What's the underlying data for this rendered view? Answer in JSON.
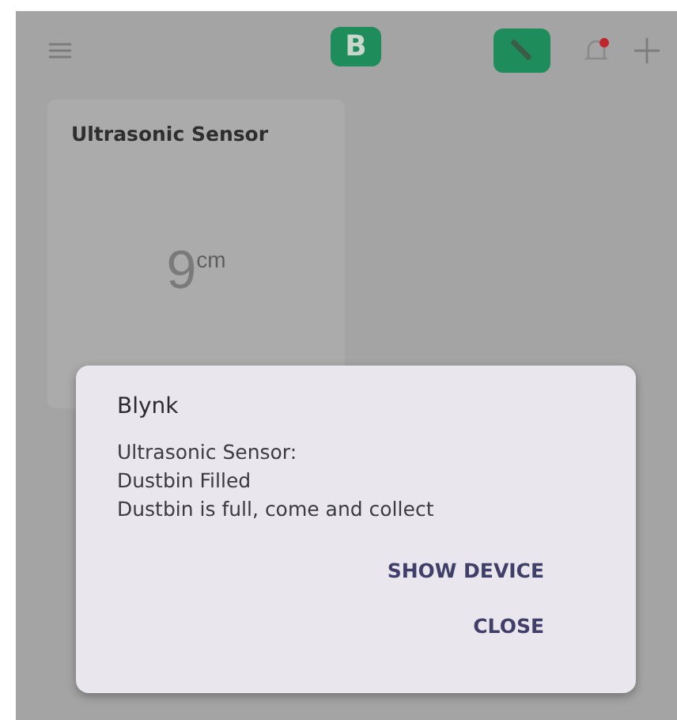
{
  "header": {
    "logo": "B"
  },
  "widget": {
    "title": "Ultrasonic Sensor",
    "value": "9",
    "unit": "cm"
  },
  "dialog": {
    "title": "Blynk",
    "lines": [
      "Ultrasonic Sensor:",
      "Dustbin Filled",
      "Dustbin is full, come and collect"
    ],
    "buttons": [
      "SHOW DEVICE",
      "CLOSE"
    ]
  }
}
